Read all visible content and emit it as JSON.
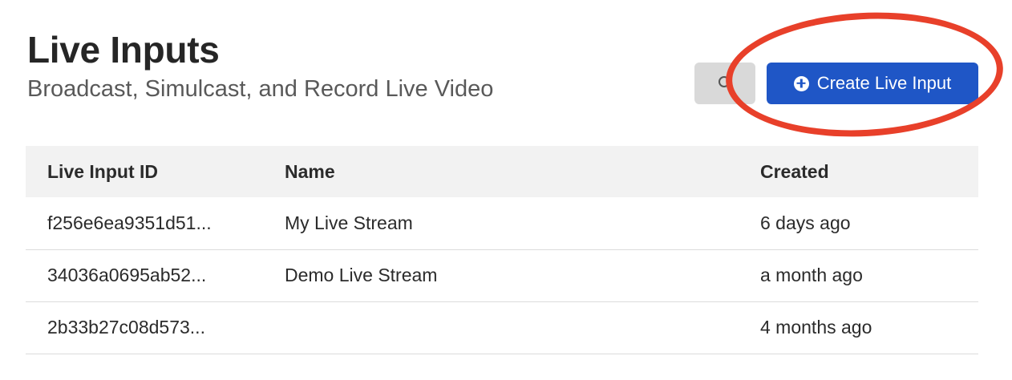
{
  "header": {
    "title": "Live Inputs",
    "subtitle": "Broadcast, Simulcast, and Record Live Video"
  },
  "actions": {
    "create_label": "Create Live Input"
  },
  "table": {
    "columns": [
      "Live Input ID",
      "Name",
      "Created"
    ],
    "rows": [
      {
        "id": "f256e6ea9351d51...",
        "name": "My Live Stream",
        "created": "6 days ago"
      },
      {
        "id": "34036a0695ab52...",
        "name": "Demo Live Stream",
        "created": "a month ago"
      },
      {
        "id": "2b33b27c08d573...",
        "name": "",
        "created": "4 months ago"
      }
    ]
  },
  "colors": {
    "primary": "#1f56c6",
    "highlight": "#e8402a",
    "header_bg": "#f2f2f2"
  }
}
